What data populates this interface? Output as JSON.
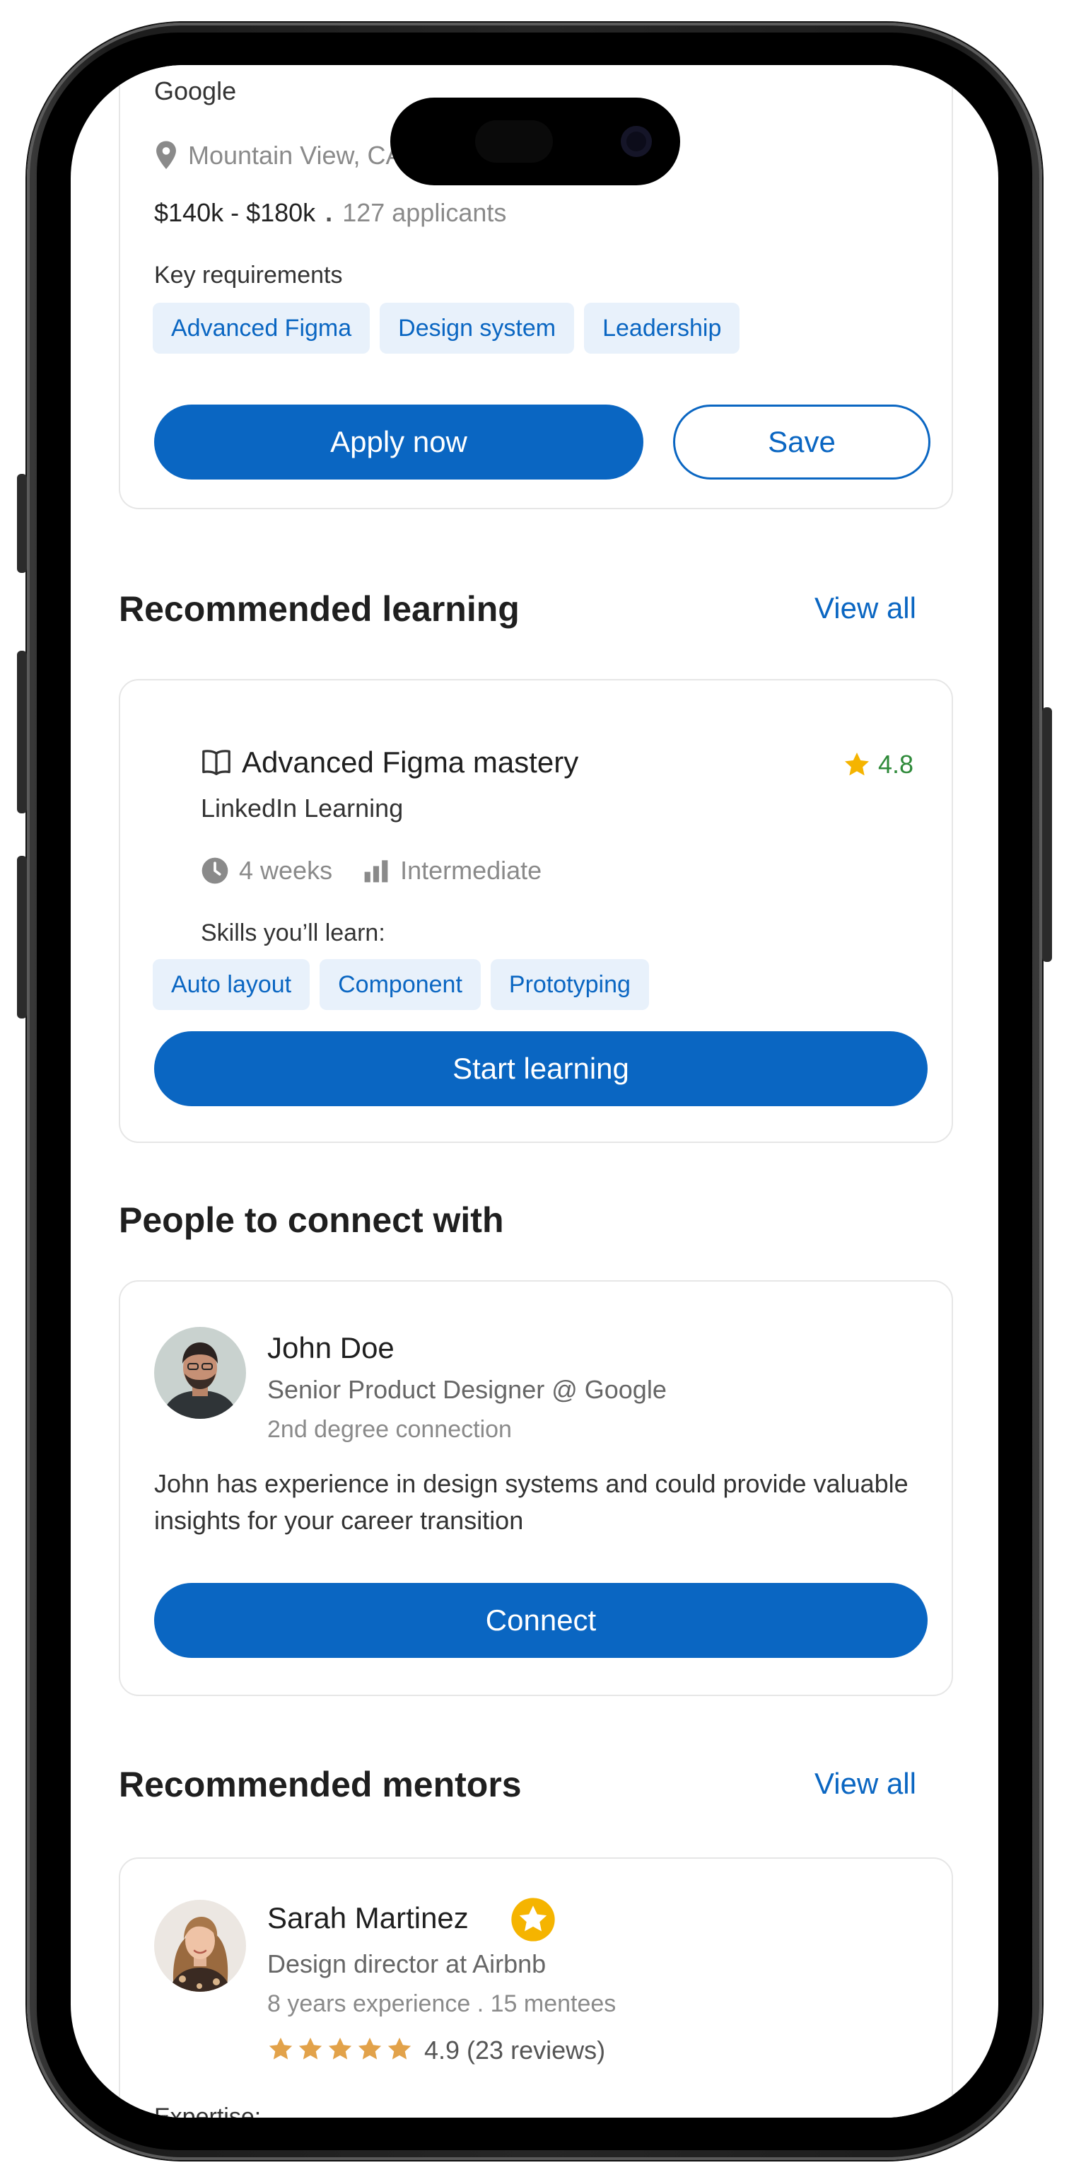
{
  "job": {
    "company": "Google",
    "location": "Mountain View, CA",
    "salary": "$140k - $180k",
    "separator": ".",
    "applicants": "127 applicants",
    "key_requirements_label": "Key requirements",
    "requirements": [
      "Advanced Figma",
      "Design system",
      "Leadership"
    ],
    "apply_label": "Apply now",
    "save_label": "Save"
  },
  "learning": {
    "section_title": "Recommended learning",
    "view_all": "View all",
    "course_title": "Advanced Figma mastery",
    "rating": "4.8",
    "provider": "LinkedIn Learning",
    "duration": "4 weeks",
    "level": "Intermediate",
    "skills_label": "Skills you’ll learn:",
    "skills": [
      "Auto layout",
      "Component",
      "Prototyping"
    ],
    "start_label": "Start learning"
  },
  "connect": {
    "section_title": "People to connect with",
    "name": "John Doe",
    "title": "Senior Product Designer @ Google",
    "degree": "2nd degree connection",
    "description": "John has experience in design systems and could provide valuable insights for your career transition",
    "connect_label": "Connect"
  },
  "mentors": {
    "section_title": "Recommended mentors",
    "view_all": "View all",
    "name": "Sarah Martinez",
    "title": "Design director at Airbnb",
    "experience": "8 years experience . 15 mentees",
    "stars": 5,
    "rating_text": "4.9 (23 reviews)",
    "expertise_label": "Expertise:"
  },
  "colors": {
    "accent": "#0a66c2",
    "chip_bg": "#e8f1fb",
    "rating_green": "#2f8a3a",
    "star_gold": "#f5b400",
    "review_star": "#e2a24a"
  },
  "icons": [
    "location-pin-icon",
    "book-icon",
    "star-icon",
    "clock-icon",
    "signal-bars-icon",
    "badge-star-icon"
  ]
}
